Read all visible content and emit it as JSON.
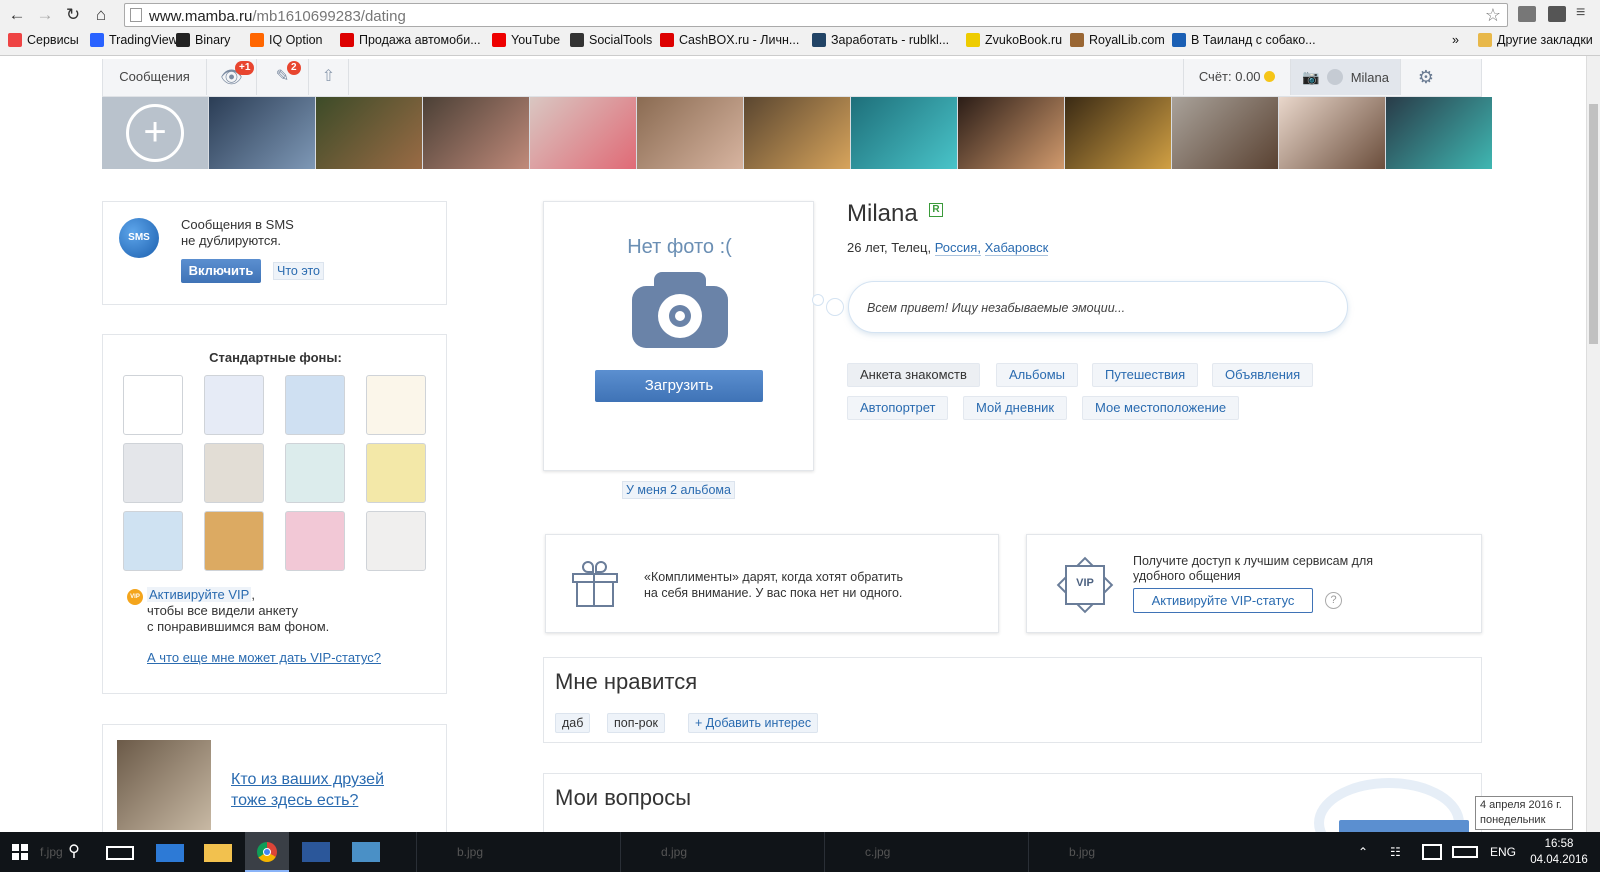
{
  "browser": {
    "url_host": "www.mamba.ru",
    "url_path": "/mb1610699283/dating",
    "bookmarks": [
      {
        "label": "Сервисы",
        "color": "#e44"
      },
      {
        "label": "TradingView",
        "color": "#2962ff"
      },
      {
        "label": "Binary",
        "color": "#222"
      },
      {
        "label": "IQ Option",
        "color": "#f60"
      },
      {
        "label": "Продажа автомоби...",
        "color": "#d00"
      },
      {
        "label": "YouTube",
        "color": "#e00"
      },
      {
        "label": "SocialTools",
        "color": "#333"
      },
      {
        "label": "CashBOX.ru - Личн...",
        "color": "#d00"
      },
      {
        "label": "Заработать - rublkl...",
        "color": "#246"
      },
      {
        "label": "ZvukoBook.ru",
        "color": "#ec0"
      },
      {
        "label": "RoyalLib.com",
        "color": "#963"
      },
      {
        "label": "В Таиланд с собако...",
        "color": "#1a5fb4"
      }
    ],
    "more": "»",
    "other_bookmarks": "Другие закладки"
  },
  "sitebar": {
    "messages": "Сообщения",
    "views_badge": "+1",
    "replies_badge": "2",
    "balance": "Счёт: 0.00",
    "username": "Milana"
  },
  "sms": {
    "line1": "Сообщения в SMS",
    "line2": "не дублируются.",
    "enable": "Включить",
    "what": "Что это",
    "icon_text": "SMS"
  },
  "backgrounds": {
    "title": "Стандартные фоны:",
    "tiles": [
      {
        "color": "#ffffff"
      },
      {
        "color": "#e6ebf6"
      },
      {
        "color": "#cfe0f2"
      },
      {
        "color": "#fbf6ea"
      },
      {
        "color": "#e4e6ea"
      },
      {
        "color": "#e2ddd5"
      },
      {
        "color": "#dcecec"
      },
      {
        "color": "#f3e8a8"
      },
      {
        "color": "#cfe2f2"
      },
      {
        "color": "#dcaa62"
      },
      {
        "color": "#f2c8d6"
      },
      {
        "color": "#f0efee"
      }
    ],
    "vip_link": "Активируйте VIP",
    "vip_text1": ",",
    "vip_text2": "чтобы все видели анкету",
    "vip_text3": "с понравившимся вам фоном.",
    "vip_more": "А что еще мне может дать VIP-статус?"
  },
  "friends": {
    "text1": "Кто из ваших друзей",
    "text2": "тоже здесь есть?"
  },
  "photo": {
    "no_photo": "Нет фото :(",
    "upload": "Загрузить",
    "albums": "У меня 2 альбома"
  },
  "profile": {
    "name": "Milana",
    "badge": "R",
    "info_prefix": "26 лет, Телец,",
    "country": "Россия,",
    "city": "Хабаровск",
    "status": "Всем привет! Ищу незабываемые эмоции..."
  },
  "tabs": [
    "Анкета знакомств",
    "Альбомы",
    "Путешествия",
    "Объявления",
    "Автопортрет",
    "Мой дневник",
    "Мое местоположение"
  ],
  "compliments": {
    "line1": "«Комплименты» дарят, когда хотят обратить",
    "line2": "на себя внимание. У вас пока нет ни одного."
  },
  "vip": {
    "line1": "Получите доступ к лучшим сервисам для",
    "line2": "удобного общения",
    "button": "Активируйте VIP-статус",
    "help": "?",
    "icon_text": "VIP"
  },
  "likes": {
    "title": "Мне нравится",
    "tags": [
      "даб",
      "поп-рок"
    ],
    "add": "+ Добавить интерес"
  },
  "questions": {
    "title": "Мои вопросы"
  },
  "taskbar": {
    "items": [
      "f.jpg",
      "b.jpg",
      "d.jpg",
      "c.jpg",
      "b.jpg"
    ],
    "lang": "ENG",
    "time": "16:58",
    "date": "04.04.2016",
    "tooltip1": "4 апреля 2016 г.",
    "tooltip2": "понедельник"
  }
}
